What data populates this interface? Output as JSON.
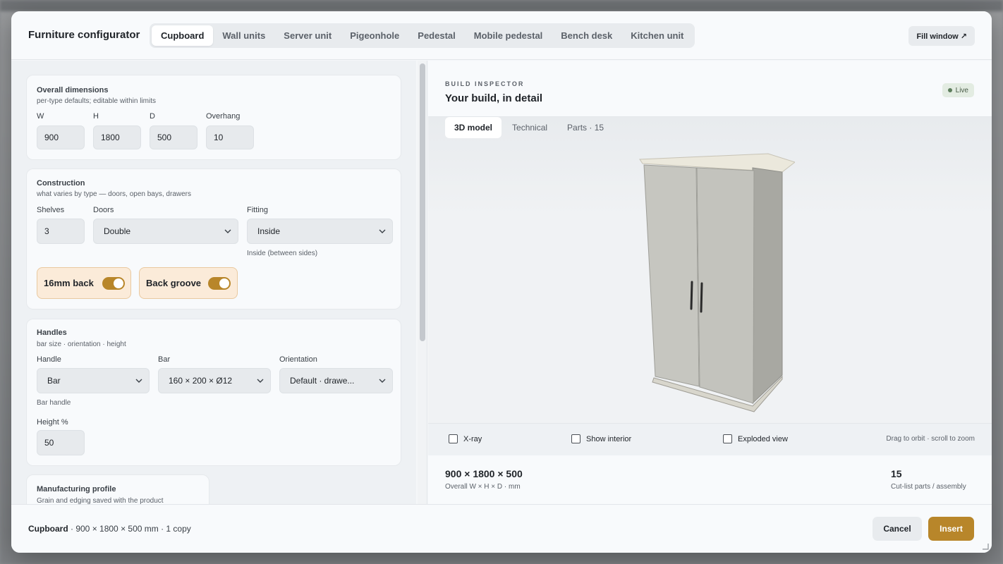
{
  "header": {
    "title": "Furniture configurator",
    "tabs": [
      {
        "label": "Cupboard",
        "active": true
      },
      {
        "label": "Wall units"
      },
      {
        "label": "Server unit"
      },
      {
        "label": "Pigeonhole"
      },
      {
        "label": "Pedestal"
      },
      {
        "label": "Mobile pedestal"
      },
      {
        "label": "Bench desk"
      },
      {
        "label": "Kitchen unit"
      }
    ],
    "fill_window_label": "Fill window ↗"
  },
  "overall": {
    "title": "Overall dimensions",
    "subtitle": "per-type defaults; editable within limits",
    "w_label": "W",
    "w_value": "900",
    "h_label": "H",
    "h_value": "1800",
    "d_label": "D",
    "d_value": "500",
    "overhang_label": "Overhang",
    "overhang_value": "10"
  },
  "construction": {
    "title": "Construction",
    "subtitle": "what varies by type — doors, open bays, drawers",
    "shelves_label": "Shelves",
    "shelves_value": "3",
    "doors_label": "Doors",
    "doors_value": "Double",
    "fitting_label": "Fitting",
    "fitting_value": "Inside",
    "fitting_hint": "Inside (between sides)",
    "toggle_back_label": "16mm back",
    "toggle_groove_label": "Back groove"
  },
  "handles": {
    "title": "Handles",
    "subtitle": "bar size · orientation · height",
    "handle_label": "Handle",
    "handle_value": "Bar",
    "handle_hint": "Bar handle",
    "bar_label": "Bar",
    "bar_value": "160 × 200 × Ø12",
    "orientation_label": "Orientation",
    "orientation_value": "Default · drawe...",
    "height_label": "Height %",
    "height_value": "50"
  },
  "manufacturing": {
    "title": "Manufacturing profile",
    "subtitle": "Grain and edging saved with the product"
  },
  "inspector": {
    "eyebrow": "BUILD INSPECTOR",
    "title": "Your build, in detail",
    "live_label": "Live",
    "tabs": [
      {
        "label": "3D model",
        "active": true
      },
      {
        "label": "Technical"
      },
      {
        "label": "Parts · 15"
      }
    ],
    "xray_label": "X-ray",
    "interior_label": "Show interior",
    "exploded_label": "Exploded view",
    "orbit_hint": "Drag to orbit · scroll to zoom",
    "dims_value": "900 × 1800 × 500",
    "dims_caption": "Overall W × H × D · mm",
    "parts_value": "15",
    "parts_caption": "Cut-list parts / assembly"
  },
  "footer": {
    "product": "Cupboard",
    "details": " · 900 × 1800 × 500 mm · 1 copy",
    "cancel_label": "Cancel",
    "insert_label": "Insert"
  },
  "colors": {
    "accent": "#b8862a",
    "toggle_bg": "#fbebd9",
    "live_dot": "#5d7d5c"
  }
}
